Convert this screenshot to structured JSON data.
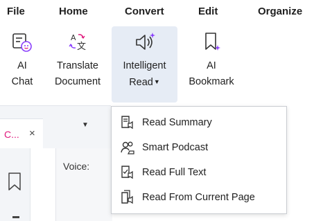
{
  "menubar": {
    "items": [
      {
        "label": "File"
      },
      {
        "label": "Home"
      },
      {
        "label": "Convert"
      },
      {
        "label": "Edit"
      },
      {
        "label": "Organize"
      }
    ]
  },
  "ribbon": {
    "buttons": [
      {
        "line1": "AI",
        "line2": "Chat",
        "icon": "ai-chat-icon"
      },
      {
        "line1": "Translate",
        "line2": "Document",
        "icon": "translate-icon"
      },
      {
        "line1": "Intelligent",
        "line2": "Read",
        "icon": "intelligent-read-icon",
        "has_dropdown": true,
        "active": true
      },
      {
        "line1": "AI",
        "line2": "Bookmark",
        "icon": "ai-bookmark-icon"
      }
    ]
  },
  "tabs": {
    "active_label": "C...",
    "close_glyph": "×",
    "chevron_glyph": "▼"
  },
  "panel": {
    "voice_label": "Voice:"
  },
  "dropdown": {
    "items": [
      {
        "label": "Read Summary",
        "icon": "read-summary-icon"
      },
      {
        "label": "Smart Podcast",
        "icon": "smart-podcast-icon"
      },
      {
        "label": "Read Full Text",
        "icon": "read-full-text-icon"
      },
      {
        "label": "Read From Current Page",
        "icon": "read-from-current-page-icon"
      }
    ]
  },
  "colors": {
    "accent_pink": "#e0197d",
    "accent_purple": "#8a3ffc",
    "active_bg": "#e6ecf5"
  }
}
